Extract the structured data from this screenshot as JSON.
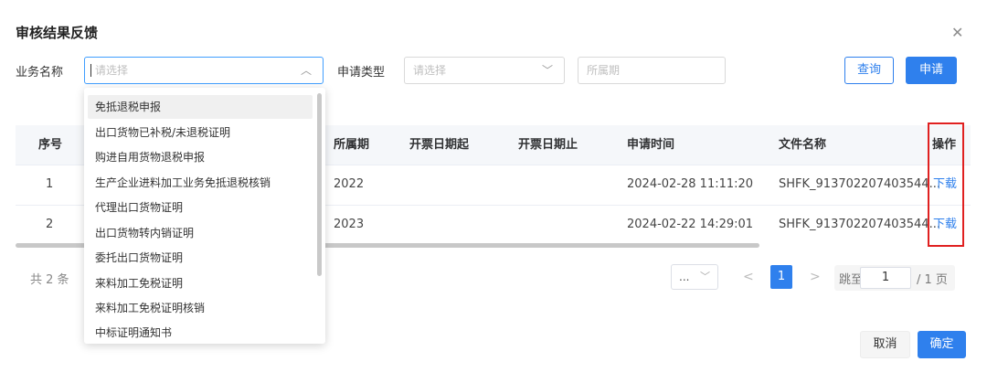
{
  "dialog": {
    "title": "审核结果反馈",
    "close_icon": "close-icon"
  },
  "filters": {
    "business_name": {
      "label": "业务名称",
      "placeholder": "请选择",
      "chevron": "chevron-up-icon"
    },
    "apply_type": {
      "label": "申请类型",
      "placeholder": "请选择",
      "chevron": "chevron-down-icon"
    },
    "period": {
      "placeholder": "所属期"
    },
    "query_label": "查询",
    "apply_label": "申请"
  },
  "dropdown": {
    "options": [
      "免抵退税申报",
      "出口货物已补税/未退税证明",
      "购进自用货物退税申报",
      "生产企业进料加工业务免抵退税核销",
      "代理出口货物证明",
      "出口货物转内销证明",
      "委托出口货物证明",
      "来料加工免税证明",
      "来料加工免税证明核销",
      "中标证明通知书"
    ],
    "selected_index": 0
  },
  "table": {
    "headers": {
      "index": "序号",
      "period": "所属期",
      "invoice_start": "开票日期起",
      "invoice_end": "开票日期止",
      "apply_time": "申请时间",
      "file_name": "文件名称",
      "action": "操作"
    },
    "rows": [
      {
        "index": "1",
        "period": "2022",
        "apply_time": "2024-02-28 11:11:20",
        "file_name": "SHFK_913702207403544...",
        "action": "下载"
      },
      {
        "index": "2",
        "period": "2023",
        "apply_time": "2024-02-22 14:29:01",
        "file_name": "SHFK_913702207403544...",
        "action": "下载"
      }
    ]
  },
  "pagination": {
    "total_text": "共 2 条",
    "page_size_text": "...",
    "prev": "<",
    "current_page": "1",
    "next": ">",
    "jump_label": "跳至",
    "jump_value": "1",
    "total_pages_text": "/ 1 页"
  },
  "footer": {
    "cancel_label": "取消",
    "confirm_label": "确定"
  },
  "colors": {
    "primary": "#2f80ed",
    "highlight": "#e02020"
  }
}
